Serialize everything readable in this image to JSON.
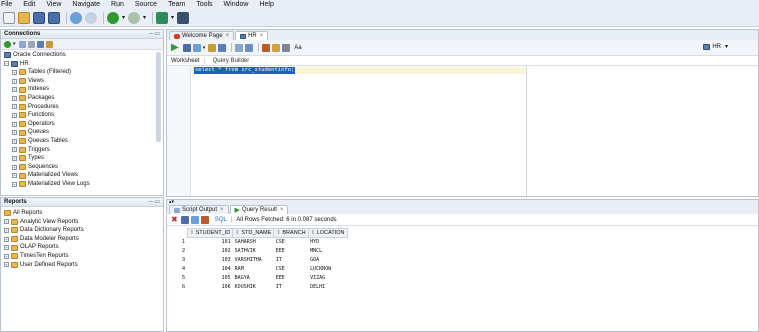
{
  "menu": [
    "File",
    "Edit",
    "View",
    "Navigate",
    "Run",
    "Source",
    "Team",
    "Tools",
    "Window",
    "Help"
  ],
  "connections_panel": {
    "title": "Connections",
    "tree": [
      {
        "label": "Oracle Connections",
        "level": 0,
        "icon": "folder"
      },
      {
        "label": "HR",
        "level": 0,
        "icon": "db"
      },
      {
        "label": "Tables (Filtered)",
        "level": 1,
        "icon": "table"
      },
      {
        "label": "Views",
        "level": 1,
        "icon": "folder"
      },
      {
        "label": "Indexes",
        "level": 1,
        "icon": "folder"
      },
      {
        "label": "Packages",
        "level": 1,
        "icon": "folder"
      },
      {
        "label": "Procedures",
        "level": 1,
        "icon": "folder"
      },
      {
        "label": "Functions",
        "level": 1,
        "icon": "folder"
      },
      {
        "label": "Operators",
        "level": 1,
        "icon": "folder"
      },
      {
        "label": "Queues",
        "level": 1,
        "icon": "folder"
      },
      {
        "label": "Queues Tables",
        "level": 1,
        "icon": "folder"
      },
      {
        "label": "Triggers",
        "level": 1,
        "icon": "folder"
      },
      {
        "label": "Types",
        "level": 1,
        "icon": "folder"
      },
      {
        "label": "Sequences",
        "level": 1,
        "icon": "folder"
      },
      {
        "label": "Materialized Views",
        "level": 1,
        "icon": "folder"
      },
      {
        "label": "Materialized View Logs",
        "level": 1,
        "icon": "folder"
      }
    ]
  },
  "reports_panel": {
    "title": "Reports",
    "tree": [
      {
        "label": "All Reports",
        "level": 0
      },
      {
        "label": "Analytic View Reports",
        "level": 1
      },
      {
        "label": "Data Dictionary Reports",
        "level": 1
      },
      {
        "label": "Data Modeler Reports",
        "level": 1
      },
      {
        "label": "OLAP Reports",
        "level": 1
      },
      {
        "label": "TimesTen Reports",
        "level": 1
      },
      {
        "label": "User Defined Reports",
        "level": 1
      }
    ]
  },
  "editor": {
    "tabs": [
      {
        "label": "Welcome Page",
        "active": false
      },
      {
        "label": "HR",
        "active": true
      }
    ],
    "connection_selector": "HR",
    "subtabs": [
      "Worksheet",
      "Query Builder"
    ],
    "sql": "select * from src_studentinfo;"
  },
  "output": {
    "tabs": [
      {
        "label": "Script Output",
        "active": false
      },
      {
        "label": "Query Result",
        "active": true
      }
    ],
    "sql_label": "SQL",
    "status": "All Rows Fetched: 6 in 0.087 seconds",
    "columns": [
      "STUDENT_ID",
      "STD_NAME",
      "BRANCH",
      "LOCATION"
    ],
    "rows": [
      {
        "n": "1",
        "cells": [
          "101",
          "SAHARSH",
          "CSE",
          "HYD"
        ]
      },
      {
        "n": "2",
        "cells": [
          "102",
          "SATHVIK",
          "EEE",
          "MNCL"
        ]
      },
      {
        "n": "3",
        "cells": [
          "103",
          "VARSHITHA",
          "IT",
          "GOA"
        ]
      },
      {
        "n": "4",
        "cells": [
          "104",
          "RAM",
          "CSE",
          "LUCKNOW"
        ]
      },
      {
        "n": "5",
        "cells": [
          "105",
          "BAGYA",
          "EEE",
          "VIZAG"
        ]
      },
      {
        "n": "6",
        "cells": [
          "106",
          "KOUSHIK",
          "IT",
          "DELHI"
        ]
      }
    ]
  },
  "colors": {
    "chrome": "#e9eef6",
    "selection": "#1f5fbf",
    "run_green": "#2e9a2e"
  }
}
